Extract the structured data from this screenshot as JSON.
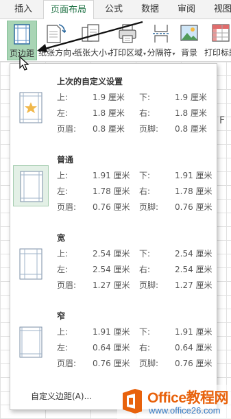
{
  "tabs": [
    "插入",
    "页面布局",
    "公式",
    "数据",
    "审阅",
    "视图"
  ],
  "active_tab": "页面布局",
  "ribbon": {
    "buttons": [
      {
        "label": "页边距",
        "icon": "margins-icon",
        "has_dropdown": false
      },
      {
        "label": "纸张方向",
        "icon": "orientation-icon",
        "has_dropdown": true
      },
      {
        "label": "纸张大小",
        "icon": "paper-size-icon",
        "has_dropdown": true
      },
      {
        "label": "打印区域",
        "icon": "print-area-icon",
        "has_dropdown": true
      },
      {
        "label": "分隔符",
        "icon": "breaks-icon",
        "has_dropdown": true
      },
      {
        "label": "背景",
        "icon": "background-icon",
        "has_dropdown": false
      },
      {
        "label": "打印标题",
        "icon": "print-titles-icon",
        "has_dropdown": false
      }
    ]
  },
  "sheet": {
    "visible_letter": "F"
  },
  "margins_menu": {
    "presets": [
      {
        "name": "上次的自定义设置",
        "icon": "star-page-icon",
        "selected": false,
        "rows": [
          [
            "上:",
            "1.9 厘米",
            "下:",
            "1.9 厘米"
          ],
          [
            "左:",
            "1.8 厘米",
            "右:",
            "1.8 厘米"
          ],
          [
            "页眉:",
            "0.8 厘米",
            "页脚:",
            "0.8 厘米"
          ]
        ]
      },
      {
        "name": "普通",
        "icon": "normal-margins-icon",
        "selected": true,
        "rows": [
          [
            "上:",
            "1.91 厘米",
            "下:",
            "1.91 厘米"
          ],
          [
            "左:",
            "1.78 厘米",
            "右:",
            "1.78 厘米"
          ],
          [
            "页眉:",
            "0.76 厘米",
            "页脚:",
            "0.76 厘米"
          ]
        ]
      },
      {
        "name": "宽",
        "icon": "wide-margins-icon",
        "selected": false,
        "rows": [
          [
            "上:",
            "2.54 厘米",
            "下:",
            "2.54 厘米"
          ],
          [
            "左:",
            "2.54 厘米",
            "右:",
            "2.54 厘米"
          ],
          [
            "页眉:",
            "1.27 厘米",
            "页脚:",
            "1.27 厘米"
          ]
        ]
      },
      {
        "name": "窄",
        "icon": "narrow-margins-icon",
        "selected": false,
        "rows": [
          [
            "上:",
            "1.91 厘米",
            "下:",
            "1.91 厘米"
          ],
          [
            "左:",
            "0.64 厘米",
            "右:",
            "0.64 厘米"
          ],
          [
            "页眉:",
            "0.76 厘米",
            "页脚:",
            "0.76 厘米"
          ]
        ]
      }
    ],
    "custom_label": "自定义边距(A)..."
  },
  "watermark": {
    "name": "Office教程网",
    "url": "www.office26.com"
  },
  "colors": {
    "accent": "#217346",
    "active_button": "#a9d5b5",
    "watermark_orange": "#e8620c",
    "watermark_blue": "#3a7ec6"
  }
}
